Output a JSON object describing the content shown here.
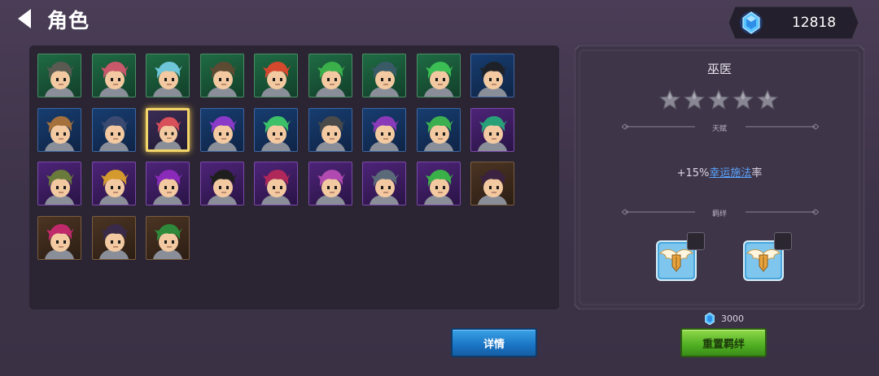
{
  "header": {
    "title": "角色",
    "back_icon": "back-arrow-icon"
  },
  "currency": {
    "icon": "gem-icon",
    "value": "12818"
  },
  "roster": {
    "tiles": [
      {
        "frame": "green",
        "hair": "#5a5a52"
      },
      {
        "frame": "green",
        "hair": "#c8586a"
      },
      {
        "frame": "green",
        "hair": "#6ec6d8"
      },
      {
        "frame": "green",
        "hair": "#5c4a32"
      },
      {
        "frame": "green",
        "hair": "#d4482e"
      },
      {
        "frame": "green",
        "hair": "#3bb04a"
      },
      {
        "frame": "green",
        "hair": "#3a5a68"
      },
      {
        "frame": "green",
        "hair": "#3bbf55"
      },
      {
        "frame": "blue",
        "hair": "#1e2228"
      },
      {
        "frame": "blue",
        "hair": "#a4703c"
      },
      {
        "frame": "blue",
        "hair": "#3a4a70"
      },
      {
        "frame": "selected",
        "hair": "#d8505a"
      },
      {
        "frame": "blue",
        "hair": "#8a3ac8"
      },
      {
        "frame": "blue",
        "hair": "#3cc068"
      },
      {
        "frame": "blue",
        "hair": "#4a4a4a"
      },
      {
        "frame": "blue",
        "hair": "#8a3ab8"
      },
      {
        "frame": "blue",
        "hair": "#3cb050"
      },
      {
        "frame": "purple",
        "hair": "#2aa078"
      },
      {
        "frame": "purple",
        "hair": "#6a7a3a"
      },
      {
        "frame": "purple",
        "hair": "#d49a2e"
      },
      {
        "frame": "purple",
        "hair": "#8a2ab8"
      },
      {
        "frame": "purple",
        "hair": "#1e1e1e"
      },
      {
        "frame": "purple",
        "hair": "#b0285a"
      },
      {
        "frame": "purple",
        "hair": "#b04ab0"
      },
      {
        "frame": "purple",
        "hair": "#5a6a78"
      },
      {
        "frame": "purple",
        "hair": "#3ab048"
      },
      {
        "frame": "brown",
        "hair": "#3a2240"
      },
      {
        "frame": "brown",
        "hair": "#c02a6a"
      },
      {
        "frame": "brown",
        "hair": "#3a2a4a"
      },
      {
        "frame": "brown",
        "hair": "#2e8a3a"
      }
    ]
  },
  "info": {
    "name": "巫医",
    "stars_total": 5,
    "stars_filled": 0,
    "talent_label": "天赋",
    "bonus_prefix": "+15%",
    "bonus_link": "幸运施法",
    "bonus_suffix": "率",
    "bond_label": "羁绊",
    "bond_icon": "winged-shield-icon"
  },
  "actions": {
    "details_label": "详情",
    "reset_label": "重置羁绊",
    "reset_cost": "3000"
  },
  "colors": {
    "background": "#3d3348",
    "panel": "#2b2533",
    "accent_blue": "#1a74c4",
    "accent_green": "#4fae22",
    "selection": "#f3d56a",
    "link": "#5aa6ff"
  }
}
